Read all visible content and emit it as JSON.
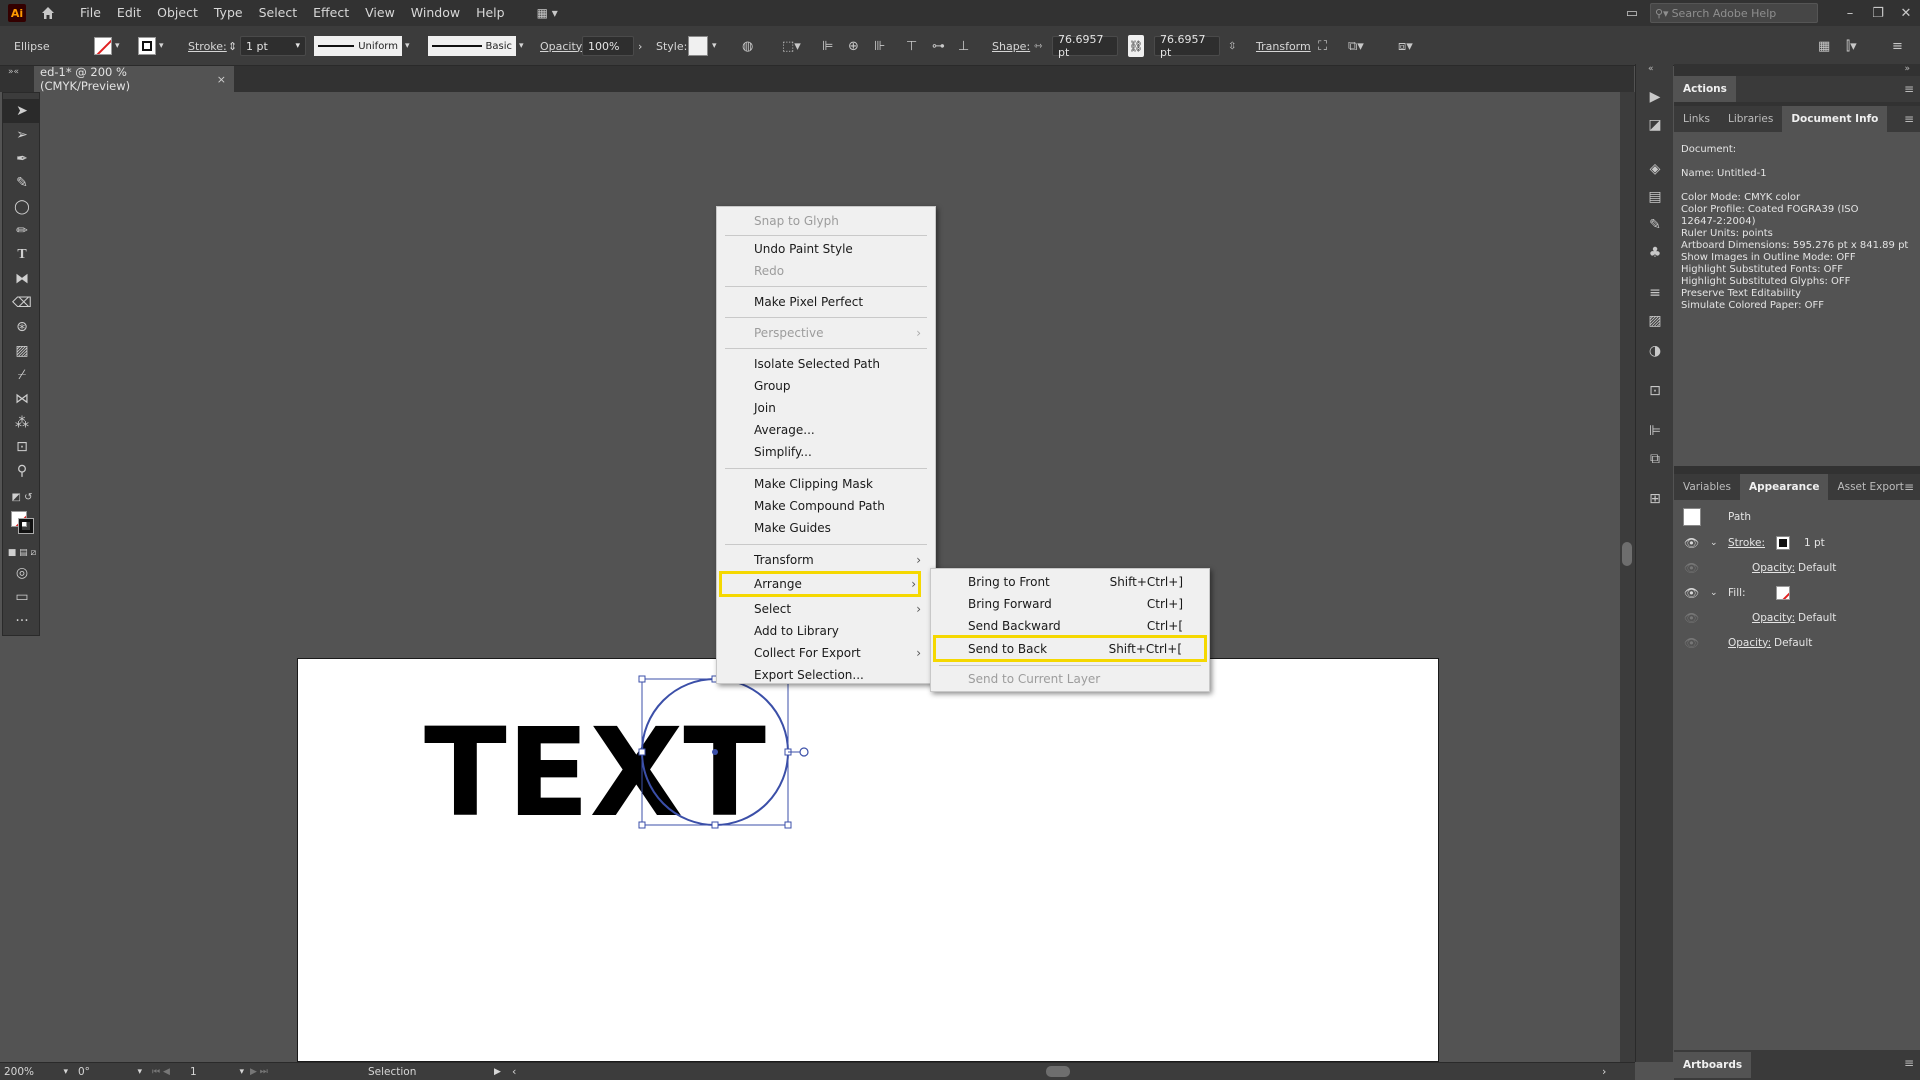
{
  "app": {
    "logo": "Ai",
    "menu": [
      "File",
      "Edit",
      "Object",
      "Type",
      "Select",
      "Effect",
      "View",
      "Window",
      "Help"
    ],
    "search_placeholder": "Search Adobe Help"
  },
  "control_bar": {
    "object_type": "Ellipse",
    "stroke_label": "Stroke:",
    "stroke_weight": "1 pt",
    "stroke_profile": "Uniform",
    "brush": "Basic",
    "opacity_label": "Opacity:",
    "opacity_value": "100%",
    "style_label": "Style:",
    "shape_label": "Shape:",
    "width_value": "76.6957 pt",
    "height_value": "76.6957 pt",
    "transform_label": "Transform"
  },
  "document_tab": {
    "title": "ed-1* @ 200 % (CMYK/Preview)",
    "close": "×"
  },
  "artwork": {
    "text": "TEXT"
  },
  "context_menu": {
    "items": [
      {
        "label": "Snap to Glyph",
        "disabled": true
      },
      {
        "label": "Undo Paint Style"
      },
      {
        "label": "Redo",
        "disabled": true
      },
      {
        "label": "Make Pixel Perfect"
      },
      {
        "label": "Perspective",
        "disabled": true,
        "submenu": true
      },
      {
        "label": "Isolate Selected Path"
      },
      {
        "label": "Group"
      },
      {
        "label": "Join"
      },
      {
        "label": "Average..."
      },
      {
        "label": "Simplify..."
      },
      {
        "label": "Make Clipping Mask"
      },
      {
        "label": "Make Compound Path"
      },
      {
        "label": "Make Guides"
      },
      {
        "label": "Transform",
        "submenu": true
      },
      {
        "label": "Arrange",
        "submenu": true,
        "highlighted": true
      },
      {
        "label": "Select",
        "submenu": true
      },
      {
        "label": "Add to Library"
      },
      {
        "label": "Collect For Export",
        "submenu": true
      },
      {
        "label": "Export Selection..."
      }
    ]
  },
  "arrange_submenu": {
    "items": [
      {
        "label": "Bring to Front",
        "shortcut": "Shift+Ctrl+]"
      },
      {
        "label": "Bring Forward",
        "shortcut": "Ctrl+]"
      },
      {
        "label": "Send Backward",
        "shortcut": "Ctrl+["
      },
      {
        "label": "Send to Back",
        "shortcut": "Shift+Ctrl+[",
        "highlighted": true
      },
      {
        "label": "Send to Current Layer",
        "disabled": true
      }
    ]
  },
  "panels": {
    "actions_title": "Actions",
    "top_tabs": [
      "Links",
      "Libraries",
      "Document Info"
    ],
    "document_info": [
      "Document:",
      "Name: Untitled-1",
      "Color Mode: CMYK color",
      "Color Profile: Coated FOGRA39 (ISO",
      "12647-2:2004)",
      "Ruler Units: points",
      "Artboard Dimensions: 595.276 pt x 841.89 pt",
      "Show Images in Outline Mode: OFF",
      "Highlight Substituted Fonts: OFF",
      "Highlight Substituted Glyphs: OFF",
      "Preserve Text Editability",
      "Simulate Colored Paper: OFF"
    ],
    "bottom_tabs": [
      "Variables",
      "Appearance",
      "Asset Export"
    ],
    "appearance": {
      "target": "Path",
      "stroke_label": "Stroke:",
      "stroke_value": "1 pt",
      "opacity_label": "Opacity:",
      "opacity_value": "Default",
      "fill_label": "Fill:"
    },
    "artboards_title": "Artboards"
  },
  "status_bar": {
    "zoom": "200%",
    "rotation": "0°",
    "artboard_number": "1",
    "tool": "Selection"
  },
  "colors": {
    "highlight": "#f5d800",
    "selection": "#3b4fa8",
    "panel_bg": "#535353",
    "menu_bg": "#f0f0f0"
  }
}
